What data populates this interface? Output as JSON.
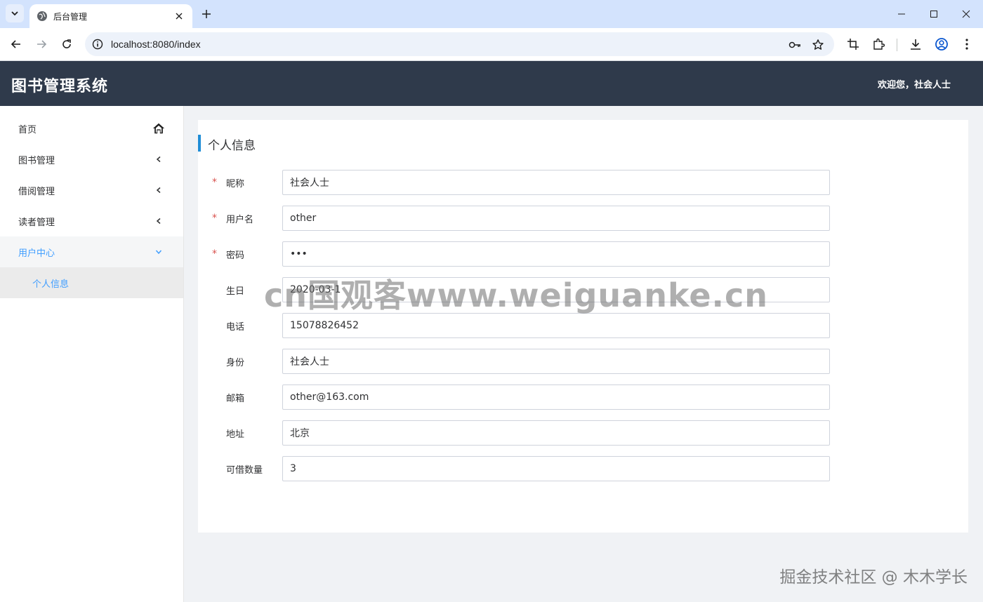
{
  "browser": {
    "tab_title": "后台管理",
    "url": "localhost:8080/index"
  },
  "header": {
    "app_title": "图书管理系统",
    "welcome": "欢迎您，社会人士"
  },
  "sidebar": {
    "items": [
      {
        "label": "首页",
        "icon": "home-icon"
      },
      {
        "label": "图书管理",
        "icon": "chevron-left-icon"
      },
      {
        "label": "借阅管理",
        "icon": "chevron-left-icon"
      },
      {
        "label": "读者管理",
        "icon": "chevron-left-icon"
      },
      {
        "label": "用户中心",
        "icon": "chevron-down-icon",
        "expanded": true
      },
      {
        "label": "个人信息",
        "active": true
      }
    ]
  },
  "card": {
    "title": "个人信息"
  },
  "form": {
    "fields": [
      {
        "label": "昵称",
        "required": true,
        "value": "社会人士"
      },
      {
        "label": "用户名",
        "required": true,
        "value": "other"
      },
      {
        "label": "密码",
        "required": true,
        "value": "•••"
      },
      {
        "label": "生日",
        "required": false,
        "value": "2020-03-1"
      },
      {
        "label": "电话",
        "required": false,
        "value": "15078826452"
      },
      {
        "label": "身份",
        "required": false,
        "value": "社会人士"
      },
      {
        "label": "邮箱",
        "required": false,
        "value": "other@163.com"
      },
      {
        "label": "地址",
        "required": false,
        "value": "北京"
      },
      {
        "label": "可借数量",
        "required": false,
        "value": "3"
      }
    ],
    "required_mark": "*"
  },
  "watermarks": {
    "center": "cn国观客www.weiguanke.cn",
    "corner": "掘金技术社区 @ 木木学长"
  },
  "colors": {
    "header_bg": "#2f3a4b",
    "accent": "#409eff",
    "title_bar": "#1f8dd6",
    "required": "#d9534f"
  }
}
